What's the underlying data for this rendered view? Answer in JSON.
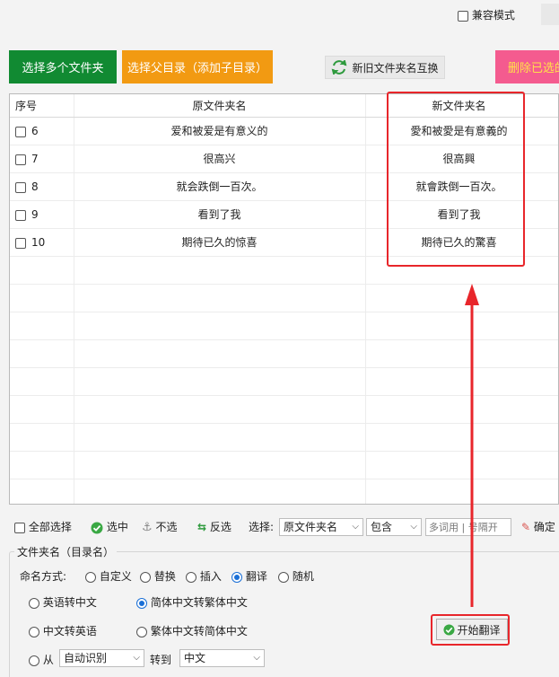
{
  "top": {
    "compat_mode_label": "兼容模式"
  },
  "buttons": {
    "select_folders": "选择多个文件夹",
    "select_parent": "选择父目录（添加子目录）",
    "swap_names": "新旧文件夹名互换",
    "delete_selected": "删除已选的"
  },
  "table": {
    "headers": {
      "index": "序号",
      "original": "原文件夹名",
      "new": "新文件夹名"
    },
    "rows": [
      {
        "index": "6",
        "original": "爱和被爱是有意义的",
        "new": "愛和被愛是有意義的"
      },
      {
        "index": "7",
        "original": "很高兴",
        "new": "很高興"
      },
      {
        "index": "8",
        "original": "就会跌倒一百次。",
        "new": "就會跌倒一百次。"
      },
      {
        "index": "9",
        "original": "看到了我",
        "new": "看到了我"
      },
      {
        "index": "10",
        "original": "期待已久的惊喜",
        "new": "期待已久的驚喜"
      }
    ]
  },
  "toolbar": {
    "select_all": "全部选择",
    "select": "选中",
    "deselect": "不选",
    "invert": "反选",
    "choose_label": "选择:",
    "choose_field": "原文件夹名",
    "match_mode": "包含",
    "keywords_placeholder": "多词用 | 号隔开",
    "confirm": "确定"
  },
  "section": {
    "title": "文件夹名（目录名）",
    "naming_label": "命名方式:",
    "naming_modes": [
      "自定义",
      "替换",
      "插入",
      "翻译",
      "随机"
    ],
    "naming_selected": "翻译",
    "translate_options": {
      "en_to_zh": "英语转中文",
      "zh_to_en": "中文转英语",
      "from_label": "从",
      "from_value": "自动识别",
      "to_label": "转到",
      "to_value": "中文",
      "s2t": "简体中文转繁体中文",
      "t2s": "繁体中文转简体中文"
    },
    "translate_selected": "简体中文转繁体中文",
    "start_button": "开始翻译"
  },
  "colors": {
    "green_button": "#118a32",
    "orange_button": "#f29a12",
    "pink_button": "#f45b8f",
    "annotation_red": "#e8262b"
  }
}
